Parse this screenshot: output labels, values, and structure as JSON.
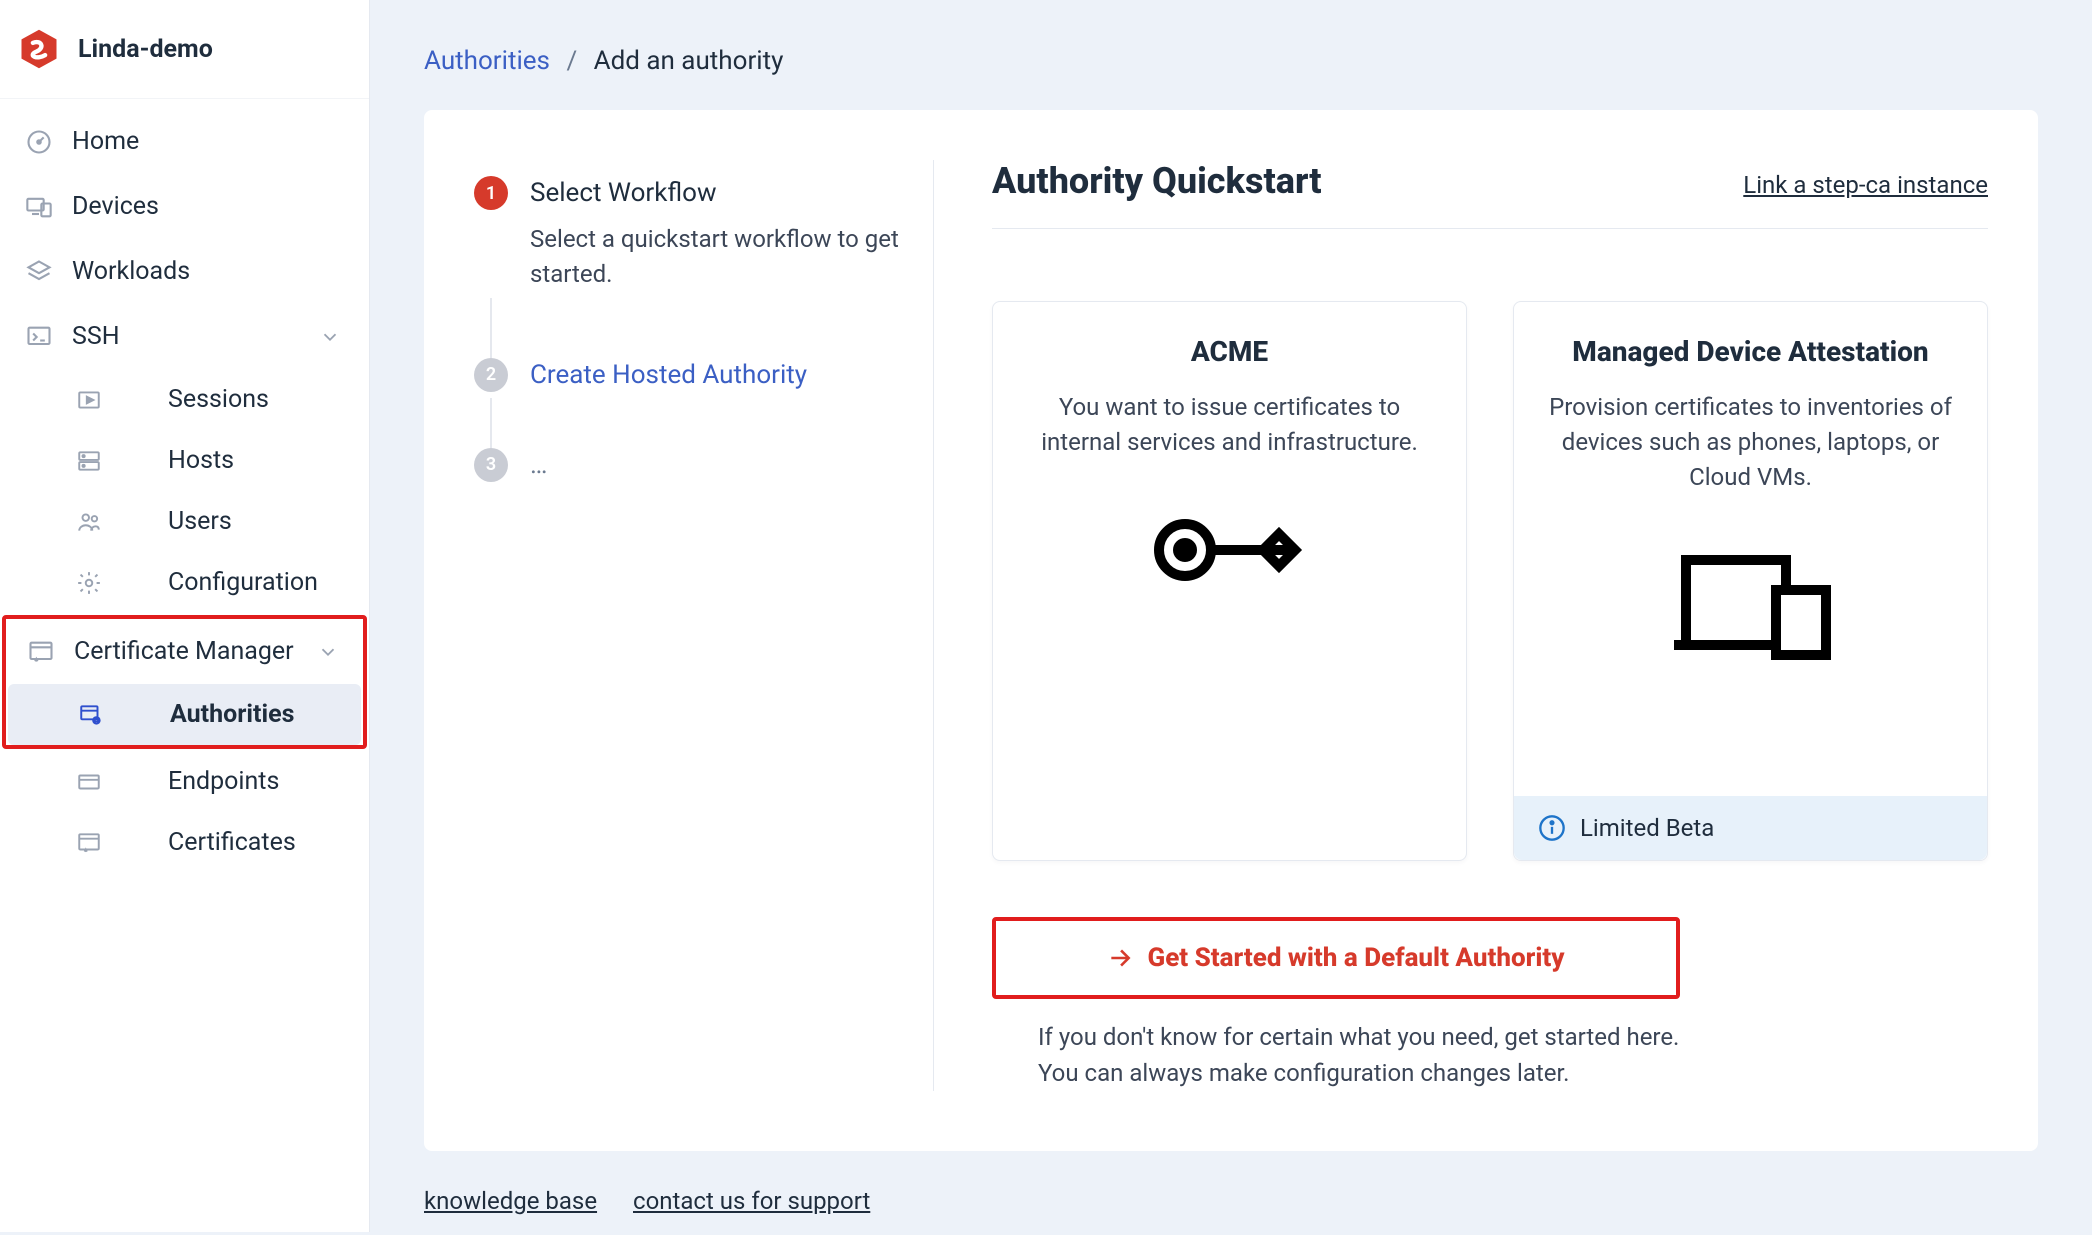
{
  "brand": {
    "name": "Linda-demo"
  },
  "nav": {
    "home": "Home",
    "devices": "Devices",
    "workloads": "Workloads",
    "ssh": "SSH",
    "ssh_children": {
      "sessions": "Sessions",
      "hosts": "Hosts",
      "users": "Users",
      "configuration": "Configuration"
    },
    "cm": "Certificate Manager",
    "cm_children": {
      "authorities": "Authorities",
      "endpoints": "Endpoints",
      "certificates": "Certificates"
    }
  },
  "breadcrumb": {
    "root": "Authorities",
    "current": "Add an authority"
  },
  "wizard": {
    "step1_title": "Select Workflow",
    "step1_desc": "Select a quickstart workflow to get started.",
    "step2_title": "Create Hosted Authority",
    "step3_title": "…"
  },
  "content": {
    "heading": "Authority Quickstart",
    "link": "Link a step-ca instance",
    "tiles": {
      "acme": {
        "title": "ACME",
        "desc": "You want to issue certificates to internal services and infrastructure."
      },
      "mda": {
        "title": "Managed Device Attestation",
        "desc": "Provision certificates to inventories of devices such as phones, laptops, or Cloud VMs.",
        "beta": "Limited Beta"
      }
    },
    "cta_label": "Get Started with a Default Authority",
    "cta_desc": "If you don't know for certain what you need, get started here. You can always make configuration changes later."
  },
  "footer": {
    "kb": "knowledge base",
    "support": "contact us for support"
  }
}
